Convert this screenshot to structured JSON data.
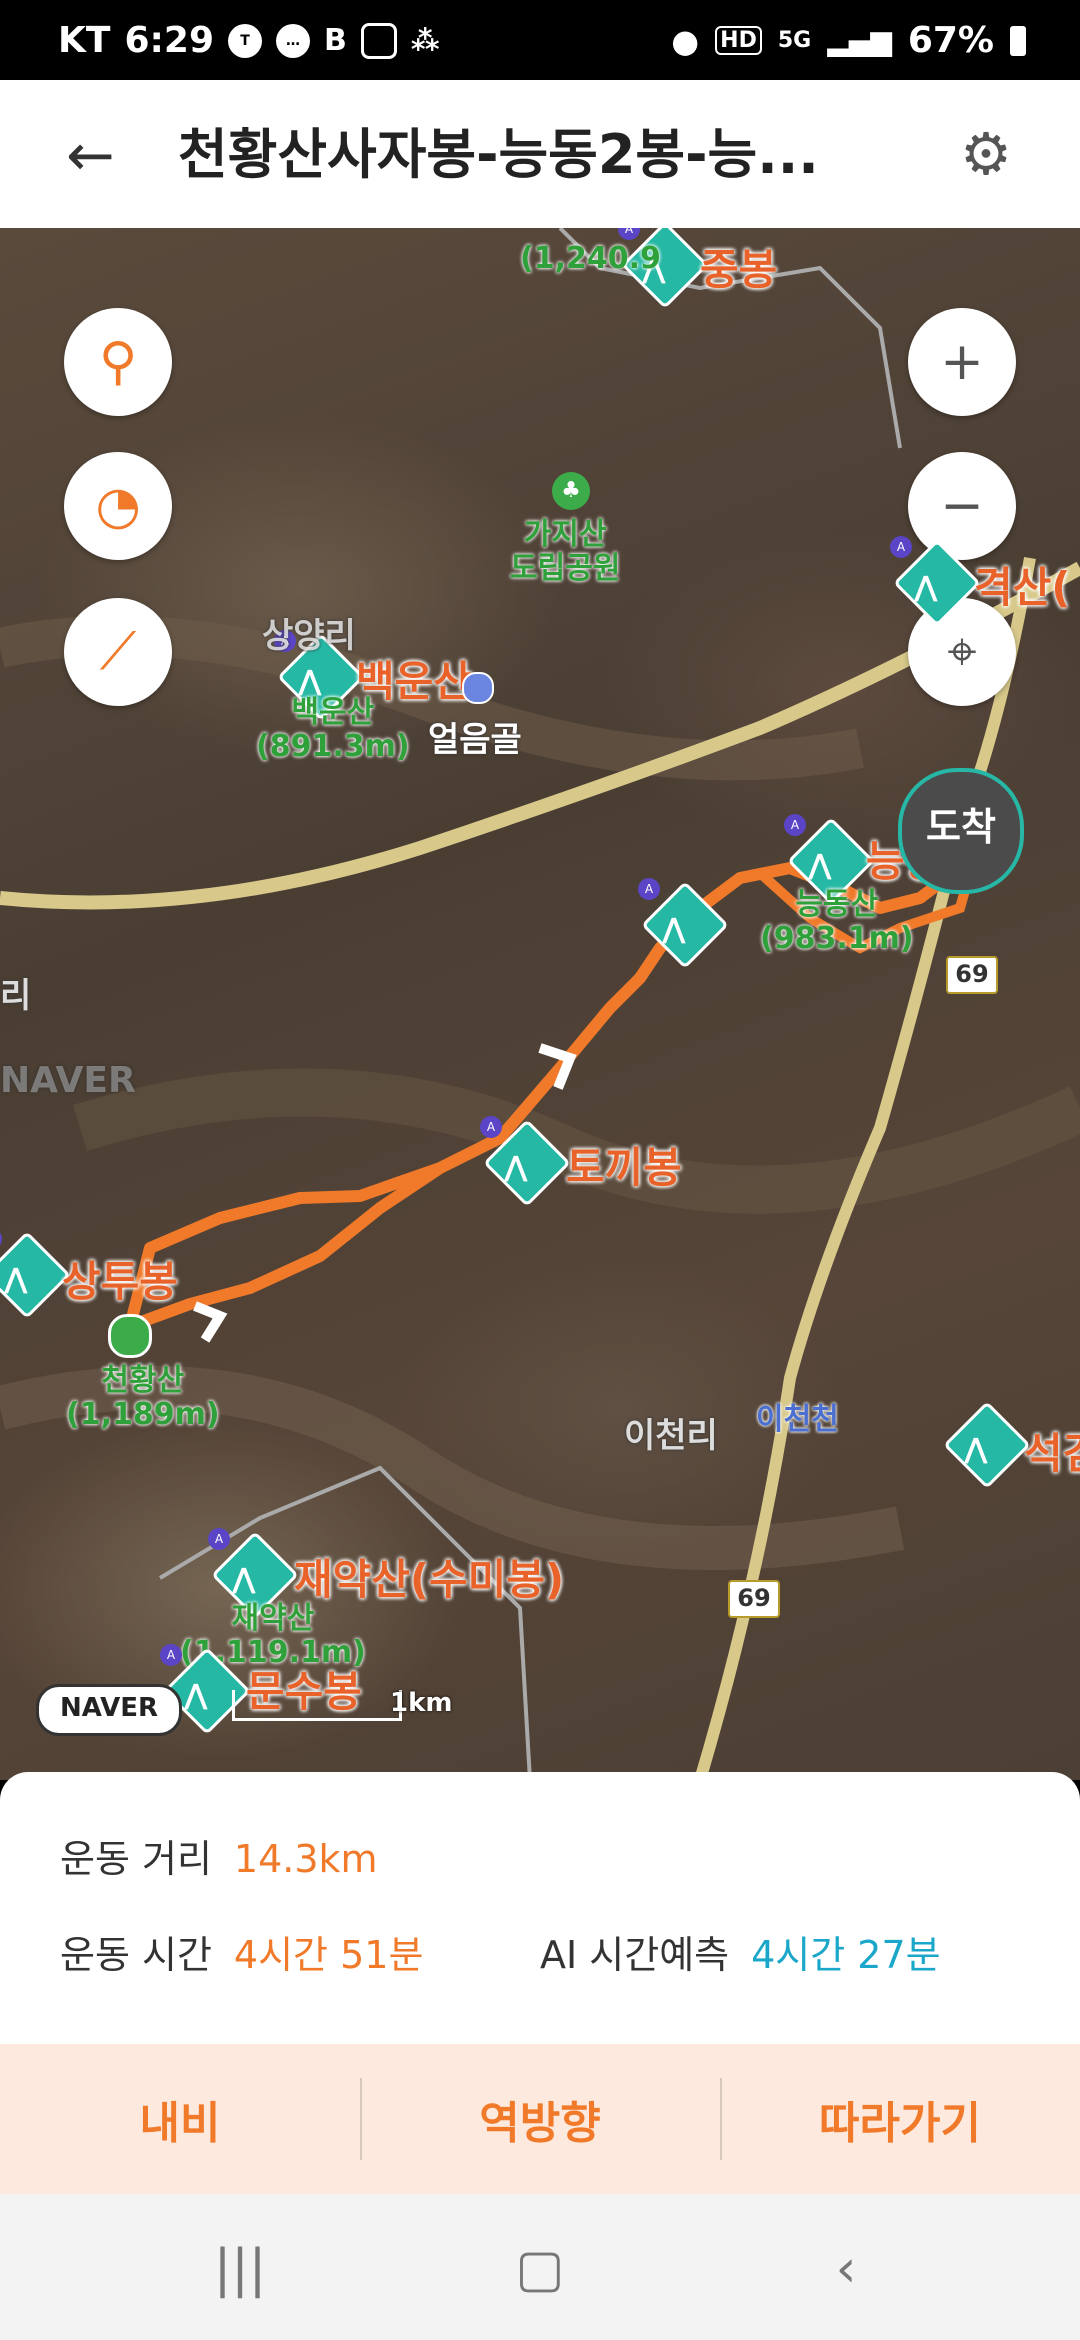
{
  "status_bar": {
    "carrier": "KT",
    "time": "6:29",
    "left_icons": [
      "talk-icon",
      "chat-bubble-icon",
      "b-app-icon",
      "instagram-icon",
      "footprint-icon"
    ],
    "right_icons": [
      "location-icon",
      "hd-icon",
      "5g-icon",
      "signal-icon"
    ],
    "battery": "67%"
  },
  "header": {
    "title": "천황산사자봉-능동2봉-능...",
    "back_icon": "back-arrow-icon",
    "settings_icon": "gear-icon"
  },
  "map": {
    "controls_left": [
      {
        "name": "location-pin-button",
        "icon": "location-pin-icon"
      },
      {
        "name": "speed-gauge-button",
        "icon": "gauge-icon"
      },
      {
        "name": "elevation-profile-button",
        "icon": "elevation-icon"
      }
    ],
    "controls_right": [
      {
        "name": "zoom-in-button",
        "glyph": "+"
      },
      {
        "name": "zoom-out-button",
        "glyph": "−"
      },
      {
        "name": "recenter-button",
        "glyph": "⌖"
      }
    ],
    "peaks": [
      {
        "name": "중봉"
      },
      {
        "name": "백운산"
      },
      {
        "name": "격산("
      },
      {
        "name": "능동"
      },
      {
        "name": "토끼봉"
      },
      {
        "name": "상투봉"
      },
      {
        "name": "재약산(수미봉)"
      },
      {
        "name": "문수봉"
      },
      {
        "name": "석검"
      }
    ],
    "green_labels": [
      {
        "text": "(1,240.9"
      },
      {
        "text": "가지산\n도립공원"
      },
      {
        "text": "백운산\n(891.3m)"
      },
      {
        "text": "능동산\n(983.1m)"
      },
      {
        "text": "천황산\n(1,189m)"
      },
      {
        "text": "재약산\n(1,119.1m)"
      }
    ],
    "place_labels": [
      "상양리",
      "얼음골",
      "이천리",
      "리"
    ],
    "stream_label": "이천천",
    "road_shield": "69",
    "arrival_label": "도착",
    "naver_logo": "NAVER",
    "scale_label": "1km",
    "watermark": "NAVER"
  },
  "stats": {
    "distance_label": "운동 거리",
    "distance_value": "14.3km",
    "time_label": "운동 시간",
    "time_value": "4시간 51분",
    "ai_label": "AI 시간예측",
    "ai_value": "4시간 27분"
  },
  "actions": {
    "navi": "내비",
    "reverse": "역방향",
    "follow": "따라가기"
  },
  "colors": {
    "accent": "#f07a2a",
    "teal": "#1ba7c9",
    "peak": "#25b8a4",
    "action_bg": "#fde9dd"
  }
}
